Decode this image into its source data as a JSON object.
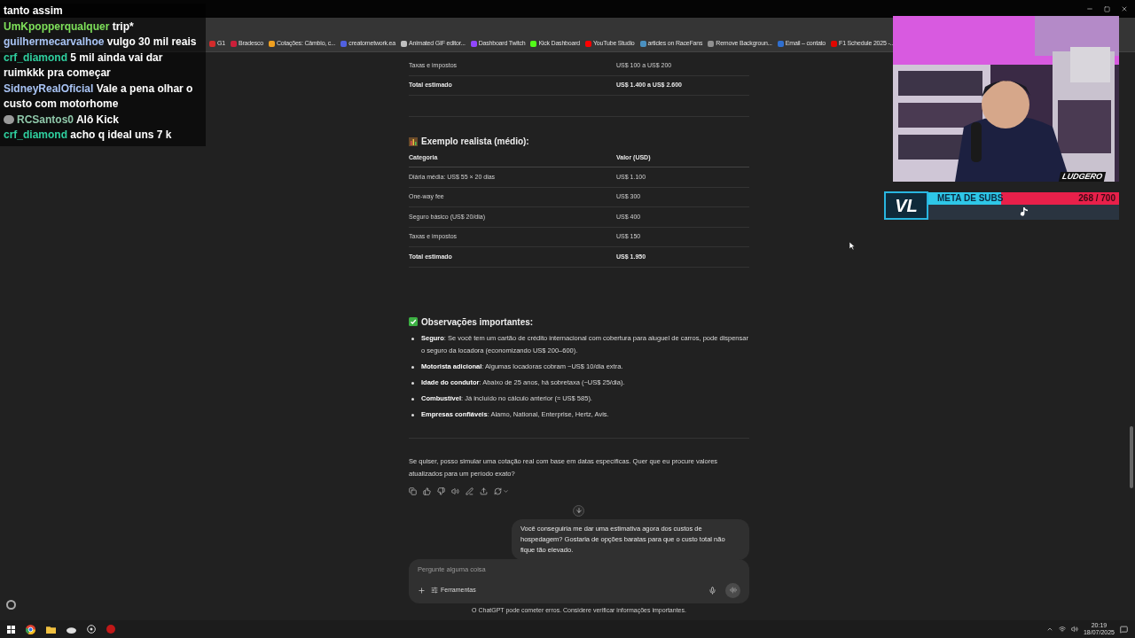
{
  "chat_overlay": {
    "messages": [
      {
        "kind": "continuation",
        "text": "tanto assim"
      },
      {
        "kind": "message",
        "user": "UmKpopperqualquer",
        "text": "trip*",
        "color": "#7ee05a"
      },
      {
        "kind": "message",
        "user": "guilhermecarvalhoe",
        "text": "vulgo 30 mil reais",
        "color": "#a9c4f5"
      },
      {
        "kind": "message",
        "user": "crf_diamond",
        "text": "5 mil ainda vai dar ruimkkk pra começar",
        "color": "#2fcf9f"
      },
      {
        "kind": "message",
        "user": "SidneyRealOficial",
        "text": "Vale a pena olhar o custo com motorhome",
        "color": "#a9c4f5"
      },
      {
        "kind": "avatar",
        "user": "RCSantos0",
        "text": "Alô Kick",
        "color": "#8fc7a9"
      },
      {
        "kind": "message",
        "user": "crf_diamond",
        "text": "acho q ideal uns 7 k",
        "color": "#2fcf9f"
      }
    ]
  },
  "browser": {
    "bookmarks": [
      {
        "label": "G1",
        "color": "#d42b2b"
      },
      {
        "label": "Bradesco",
        "color": "#cc1f3a"
      },
      {
        "label": "Cotações: Câmbio, c...",
        "color": "#f0a020"
      },
      {
        "label": "creatornetwork.ea",
        "color": "#5060e0"
      },
      {
        "label": "Animated GIF editor...",
        "color": "#c0c0c0"
      },
      {
        "label": "Dashboard Twitch",
        "color": "#9146ff"
      },
      {
        "label": "Kick Dashboard",
        "color": "#53fc18"
      },
      {
        "label": "YouTube Studio",
        "color": "#ff0000"
      },
      {
        "label": "articles on RaceFans",
        "color": "#4a90c0"
      },
      {
        "label": "Remove Backgroun...",
        "color": "#909090"
      },
      {
        "label": "Email – contato",
        "color": "#2f6fd0"
      },
      {
        "label": "F1 Schedule 2025 -...",
        "color": "#e10600"
      }
    ]
  },
  "conversation": {
    "previous_rows": [
      {
        "category": "Taxas e impostos",
        "value": "US$ 100 a US$ 200",
        "bold": false
      },
      {
        "category": "Total estimado",
        "value": "US$ 1.400 a US$ 2.600",
        "bold": true
      }
    ],
    "example": {
      "title": "Exemplo realista (médio):",
      "columns": [
        "Categoria",
        "Valor (USD)"
      ],
      "rows": [
        {
          "category": "Diária média: US$ 55 × 20 dias",
          "value": "US$ 1.100",
          "bold": false
        },
        {
          "category": "One-way fee",
          "value": "US$ 300",
          "bold": false
        },
        {
          "category": "Seguro básico (US$ 20/dia)",
          "value": "US$ 400",
          "bold": false
        },
        {
          "category": "Taxas e impostos",
          "value": "US$ 150",
          "bold": false
        },
        {
          "category": "Total estimado",
          "value": "US$ 1.950",
          "bold": true
        }
      ]
    },
    "notes": {
      "title": "Observações importantes:",
      "items": [
        "**Seguro**: Se você tem um cartão de crédito internacional com cobertura para aluguel de carros, pode dispensar o seguro da locadora (economizando US$ 200–600).",
        "**Motorista adicional**: Algumas locadoras cobram ~US$ 10/dia extra.",
        "**Idade do condutor**: Abaixo de 25 anos, há sobretaxa (~US$ 25/dia).",
        "**Combustível**: Já incluído no cálculo anterior (≈ US$ 585).",
        "**Empresas confiáveis**: Alamo, National, Enterprise, Hertz, Avis."
      ]
    },
    "closing": "Se quiser, posso simular uma cotação real com base em datas específicas. Quer que eu procure valores atualizados para um período exato?",
    "user_message": "Você conseguiria me dar uma estimativa agora dos custos de hospedagem? Gostaria de opções baratas para que o custo total não fique tão elevado."
  },
  "composer": {
    "placeholder": "Pergunte alguma coisa",
    "tools_label": "Ferramentas"
  },
  "disclaimer": "O ChatGPT pode cometer erros. Considere verificar informações importantes.",
  "stream": {
    "brand": "LUDGERO",
    "logo": "VL",
    "goal_label": "META DE SUBS",
    "goal_count": "268 / 700",
    "level": 0.383
  },
  "taskbar": {
    "time": "20:19",
    "date": "18/07/2025"
  }
}
